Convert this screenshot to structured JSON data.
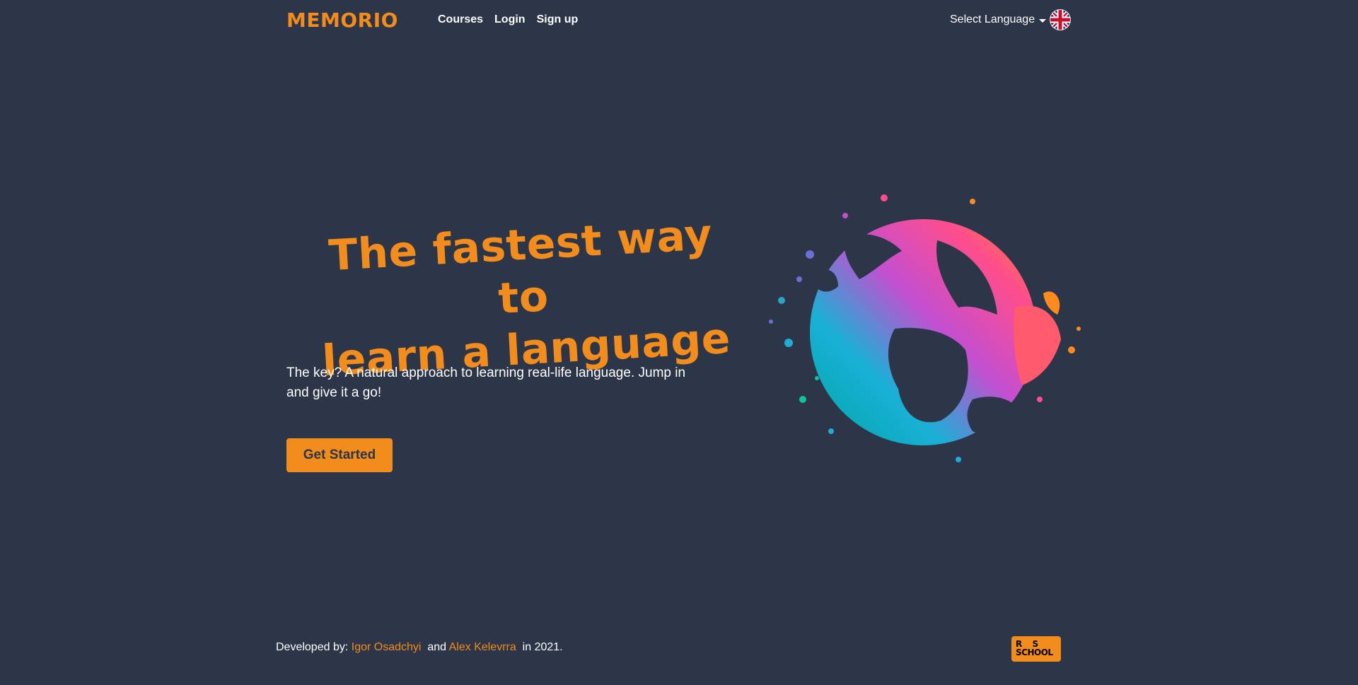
{
  "nav": {
    "brand": "MEMORIO",
    "links": [
      "Courses",
      "Login",
      "Sign up"
    ],
    "language_select": "Select Language",
    "flag_icon": "uk-flag-icon"
  },
  "hero": {
    "title_line1": "The fastest way to",
    "title_line2": "learn a language",
    "subtitle_line1": "The key? A natural approach to learning real-life language. Jump in",
    "subtitle_line2": "and give it a go!",
    "cta": "Get Started",
    "illustration": "colorful-globe-illustration"
  },
  "footer": {
    "prefix": "Developed by:",
    "author1": "Igor Osadchyi",
    "connector": "and",
    "author2": "Alex Kelevrra",
    "suffix": "in 2021.",
    "logo": "rs-school-logo",
    "logo_text": "RS SCHOOL"
  },
  "colors": {
    "background": "#2d3548",
    "accent": "#f28c1d",
    "text": "#ffffff"
  }
}
